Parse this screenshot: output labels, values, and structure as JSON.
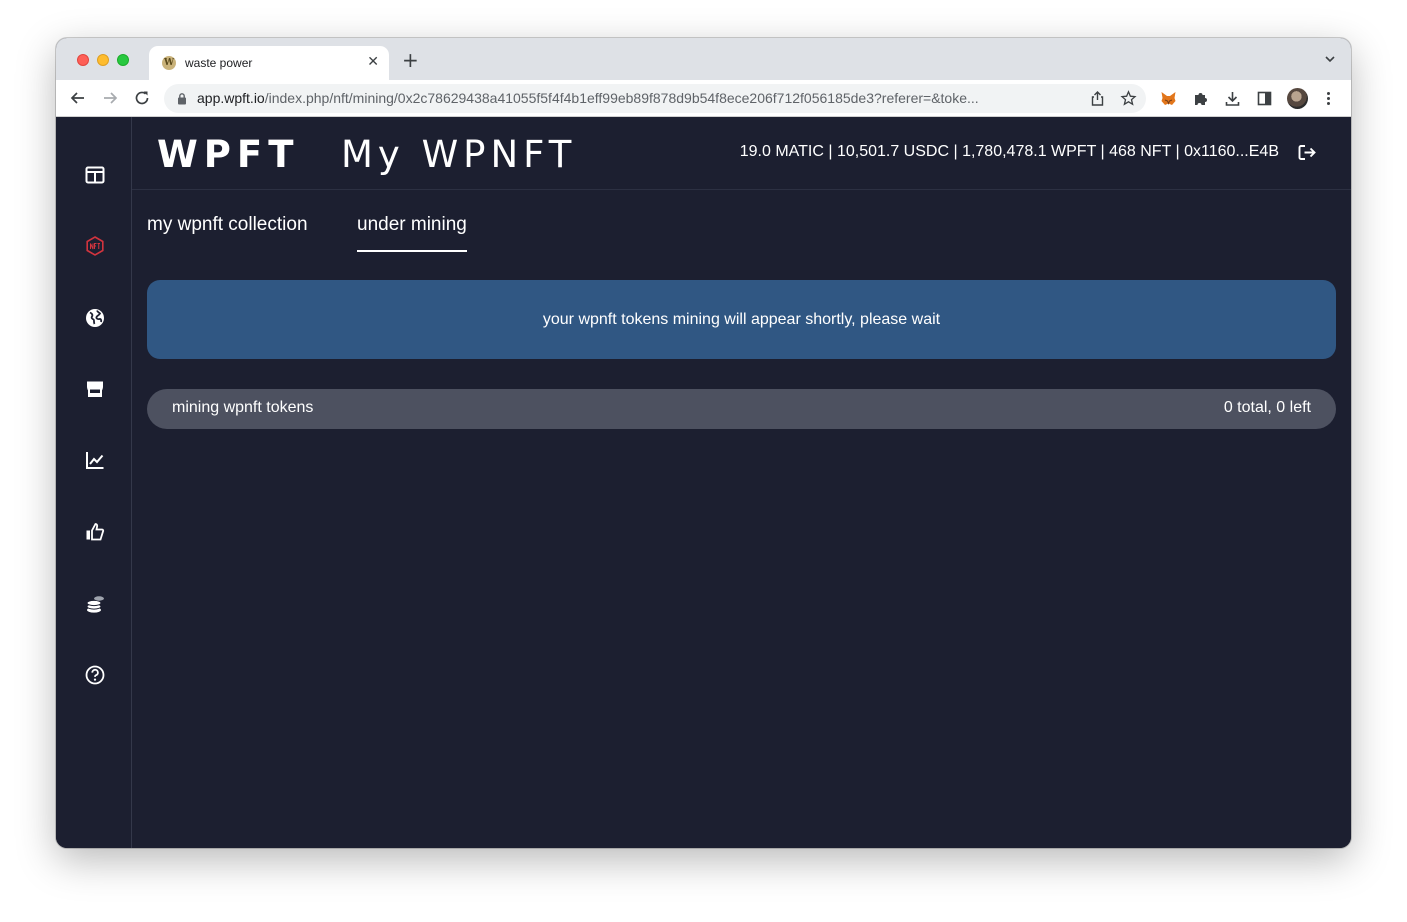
{
  "browser": {
    "tab_title": "waste power",
    "tab_favicon_letter": "W",
    "url_host": "app.wpft.io",
    "url_rest": "/index.php/nft/mining/0x2c78629438a41055f5f4f4b1eff99eb89f878d9b54f8ece206f712f056185de3?referer=&toke..."
  },
  "header": {
    "brand": "WPFT",
    "title": "My WPNFT",
    "balances": "19.0 MATIC | 10,501.7 USDC | 1,780,478.1 WPFT | 468 NFT | 0x1160...E4B"
  },
  "tabs": [
    {
      "label": "my wpnft collection",
      "active": false
    },
    {
      "label": "under mining",
      "active": true
    }
  ],
  "notice": "your wpnft tokens mining will appear shortly, please wait",
  "summary": {
    "label": "mining wpnft tokens",
    "count": "0 total, 0 left"
  },
  "sidebar": {
    "items": [
      {
        "icon": "dashboard-icon",
        "active": false
      },
      {
        "icon": "nft-icon",
        "active": true
      },
      {
        "icon": "globe-icon",
        "active": false
      },
      {
        "icon": "store-icon",
        "active": false
      },
      {
        "icon": "chart-icon",
        "active": false
      },
      {
        "icon": "thumbs-up-icon",
        "active": false
      },
      {
        "icon": "coins-icon",
        "active": false
      },
      {
        "icon": "help-icon",
        "active": false
      }
    ]
  },
  "colors": {
    "app_background": "#1c1f30",
    "notice_background": "#305783",
    "summary_background": "#4d5160",
    "active_sidebar_icon": "#d2343e"
  }
}
